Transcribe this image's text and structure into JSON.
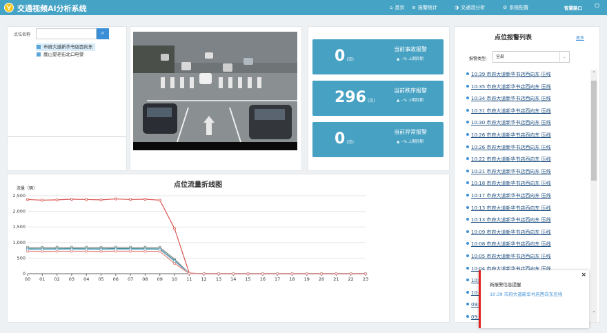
{
  "header": {
    "title": "交通视频AI分析系统",
    "nav": [
      {
        "icon": "home-icon",
        "glyph": "⌂",
        "label": "首页"
      },
      {
        "icon": "list-icon",
        "glyph": "≡",
        "label": "报警统计"
      },
      {
        "icon": "pie-icon",
        "glyph": "◑",
        "label": "交通流分析"
      },
      {
        "icon": "gear-icon",
        "glyph": "⚙",
        "label": "系统配置"
      }
    ],
    "user": "智慧路口",
    "power_glyph": "⏻"
  },
  "location": {
    "search_label": "点位名称",
    "search_value": "",
    "search_glyph": "⌕",
    "items": [
      {
        "label": "市府大道新华书店西向东",
        "selected": true
      },
      {
        "label": "鹿山望老街北口电警",
        "selected": false
      }
    ]
  },
  "stats": [
    {
      "value": "0",
      "unit": "(次)",
      "label": "当前事故报警",
      "compare": "▲ --%  上期同期"
    },
    {
      "value": "296",
      "unit": "(次)",
      "label": "当前秩序报警",
      "compare": "▲ --%  上期同期"
    },
    {
      "value": "0",
      "unit": "(次)",
      "label": "当前异常报警",
      "compare": "▲ --%  上期同期"
    }
  ],
  "chart_data": {
    "type": "line",
    "title": "点位流量折线图",
    "ylabel": "流量（辆）",
    "x": [
      "00",
      "01",
      "02",
      "03",
      "04",
      "05",
      "06",
      "07",
      "08",
      "09",
      "10",
      "11",
      "12",
      "13",
      "14",
      "15",
      "16",
      "17",
      "18",
      "19",
      "20",
      "21",
      "22",
      "23"
    ],
    "ylim": [
      0,
      2500
    ],
    "yticks": [
      0,
      500,
      1000,
      1500,
      2000,
      2500
    ],
    "grid": true,
    "series": [
      {
        "color": "#d9534f",
        "values": [
          2380,
          2360,
          2370,
          2390,
          2380,
          2370,
          2400,
          2380,
          2390,
          2360,
          1450,
          20,
          0,
          0,
          0,
          0,
          0,
          0,
          0,
          0,
          0,
          0,
          0,
          0
        ]
      },
      {
        "color": "#888888",
        "values": [
          850,
          845,
          848,
          850,
          848,
          846,
          852,
          850,
          848,
          845,
          470,
          10,
          0,
          0,
          0,
          0,
          0,
          0,
          0,
          0,
          0,
          0,
          0,
          0
        ]
      },
      {
        "color": "#2e7d80",
        "values": [
          800,
          798,
          800,
          802,
          800,
          798,
          805,
          802,
          800,
          798,
          420,
          8,
          0,
          0,
          0,
          0,
          0,
          0,
          0,
          0,
          0,
          0,
          0,
          0
        ]
      },
      {
        "color": "#7ab8d8",
        "values": [
          780,
          778,
          780,
          782,
          780,
          778,
          785,
          782,
          780,
          778,
          400,
          8,
          0,
          0,
          0,
          0,
          0,
          0,
          0,
          0,
          0,
          0,
          0,
          0
        ]
      },
      {
        "color": "#e8877f",
        "values": [
          720,
          716,
          718,
          720,
          718,
          716,
          722,
          720,
          718,
          716,
          330,
          5,
          0,
          0,
          0,
          0,
          0,
          0,
          0,
          0,
          0,
          0,
          0,
          0
        ]
      }
    ]
  },
  "alarms": {
    "title": "点位报警列表",
    "more": "更多",
    "type_label": "报警类型:",
    "type_value": "全部",
    "items": [
      "10:39 市府大道新华书店西向东 压线",
      "10:35 市府大道新华书店西向东 压线",
      "10:34 市府大道新华书店西向东 压线",
      "10:31 市府大道新华书店西向东 压线",
      "10:30 市府大道新华书店西向东 压线",
      "10:26 市府大道新华书店西向东 压线",
      "10:26 市府大道新华书店西向东 压线",
      "10:22 市府大道新华书店西向东 压线",
      "10:21 市府大道新华书店西向东 压线",
      "10:18 市府大道新华书店西向东 压线",
      "10:17 市府大道新华书店西向东 压线",
      "10:13 市府大道新华书店西向东 压线",
      "10:13 市府大道新华书店西向东 压线",
      "10:09 市府大道新华书店西向东 压线",
      "10:08 市府大道新华书店西向东 压线",
      "10:05 市府大道新华书店西向东 压线",
      "10:04 市府大道新华书店西向东 压线",
      "10:",
      "10:",
      "09:",
      "09:"
    ]
  },
  "toast": {
    "title": "新报警信息提醒",
    "message": "10:39   市府大道新华书店西向东压线",
    "close": "×"
  },
  "colors": {
    "header": "#45a3c5",
    "stat_card": "#46a1c3",
    "accent": "#3b8fd6",
    "alert": "#e02020"
  }
}
